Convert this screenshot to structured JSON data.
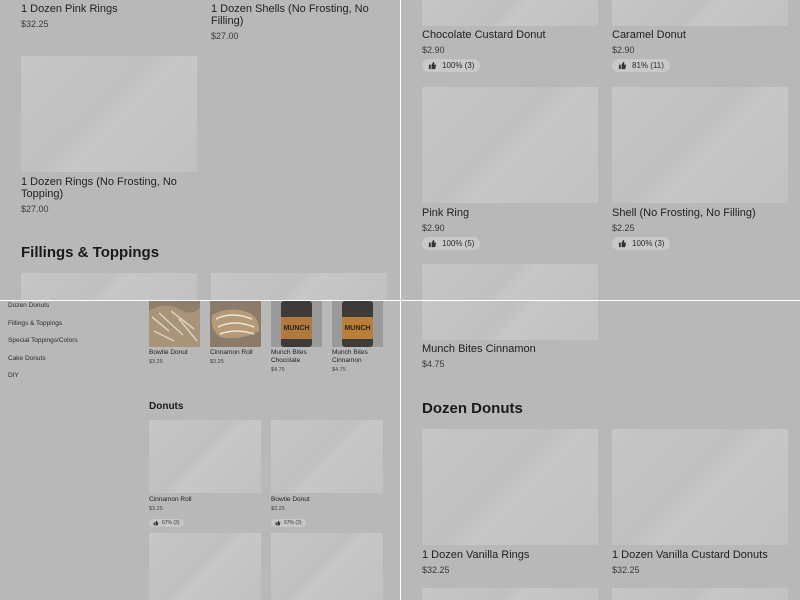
{
  "colors": {
    "overlay": "#b8b8b8",
    "placeholder": "#c4c4c4",
    "badge": "#c9c9c9",
    "separator": "#ffffff"
  },
  "top_left": {
    "items": [
      {
        "name": "1 Dozen Pink Rings",
        "price": "$32.25"
      },
      {
        "name": "1 Dozen Shells (No Frosting, No Filling)",
        "price": "$27.00"
      },
      {
        "name": "1 Dozen Rings (No Frosting, No Topping)",
        "price": "$27.00"
      }
    ],
    "section_heading": "Fillings & Toppings"
  },
  "top_right": {
    "items": [
      {
        "name": "Chocolate Custard Donut",
        "price": "$2.90",
        "rating": "100% (3)"
      },
      {
        "name": "Caramel Donut",
        "price": "$2.90",
        "rating": "81% (11)"
      },
      {
        "name": "Pink Ring",
        "price": "$2.90",
        "rating": "100% (5)"
      },
      {
        "name": "Shell (No Frosting, No Filling)",
        "price": "$2.25",
        "rating": "100% (3)"
      }
    ]
  },
  "bottom_left": {
    "sidebar": [
      "Dozen Donuts",
      "Fillings & Toppings",
      "Special Toppings/Colors",
      "Cake Donuts",
      "DIY"
    ],
    "photo_items": [
      {
        "name": "Bowtie Donut",
        "price": "$3.25",
        "icon": "donut-photo"
      },
      {
        "name": "Cinnamon Roll",
        "price": "$3.25",
        "icon": "donut-photo"
      },
      {
        "name": "Munch Bites Chocolate",
        "price": "$4.75",
        "icon": "munch-jar-photo",
        "jar_label": "MUNCH"
      },
      {
        "name": "Munch Bites Cinnamon",
        "price": "$4.75",
        "icon": "munch-jar-photo",
        "jar_label": "MUNCH"
      }
    ],
    "section_heading": "Donuts",
    "donut_items": [
      {
        "name": "Cinnamon Roll",
        "price": "$3.25",
        "rating": "67% (3)"
      },
      {
        "name": "Bowtie Donut",
        "price": "$3.25",
        "rating": "67% (3)"
      }
    ]
  },
  "bottom_right": {
    "items": [
      {
        "name": "Munch Bites Cinnamon",
        "price": "$4.75"
      },
      {
        "name": "1 Dozen Vanilla Rings",
        "price": "$32.25"
      },
      {
        "name": "1 Dozen Vanilla Custard Donuts",
        "price": "$32.25"
      }
    ],
    "section_heading": "Dozen Donuts"
  }
}
